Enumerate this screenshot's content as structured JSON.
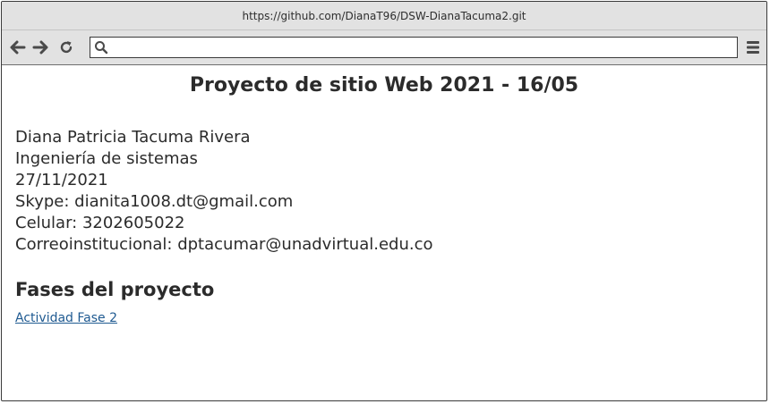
{
  "browser": {
    "url": "https://github.com/DianaT96/DSW-DianaTacuma2.git",
    "address_value": ""
  },
  "page": {
    "title": "Proyecto de sitio Web 2021 - 16/05",
    "info": {
      "name": "Diana Patricia Tacuma Rivera",
      "program": "Ingeniería de sistemas",
      "date": "27/11/2021",
      "skype": "Skype: dianita1008.dt@gmail.com",
      "phone": "Celular: 3202605022",
      "email": "Correoinstitucional: dptacumar@unadvirtual.edu.co"
    },
    "section_title": "Fases del proyecto",
    "link_label": "Actividad Fase 2"
  },
  "colors": {
    "chrome": "#e2e2e2",
    "text": "#2b2b2b",
    "link": "#1f5a91"
  },
  "icons": {
    "back": "arrow-left-icon",
    "forward": "arrow-right-icon",
    "reload": "reload-icon",
    "search": "search-icon",
    "menu": "hamburger-menu-icon"
  }
}
